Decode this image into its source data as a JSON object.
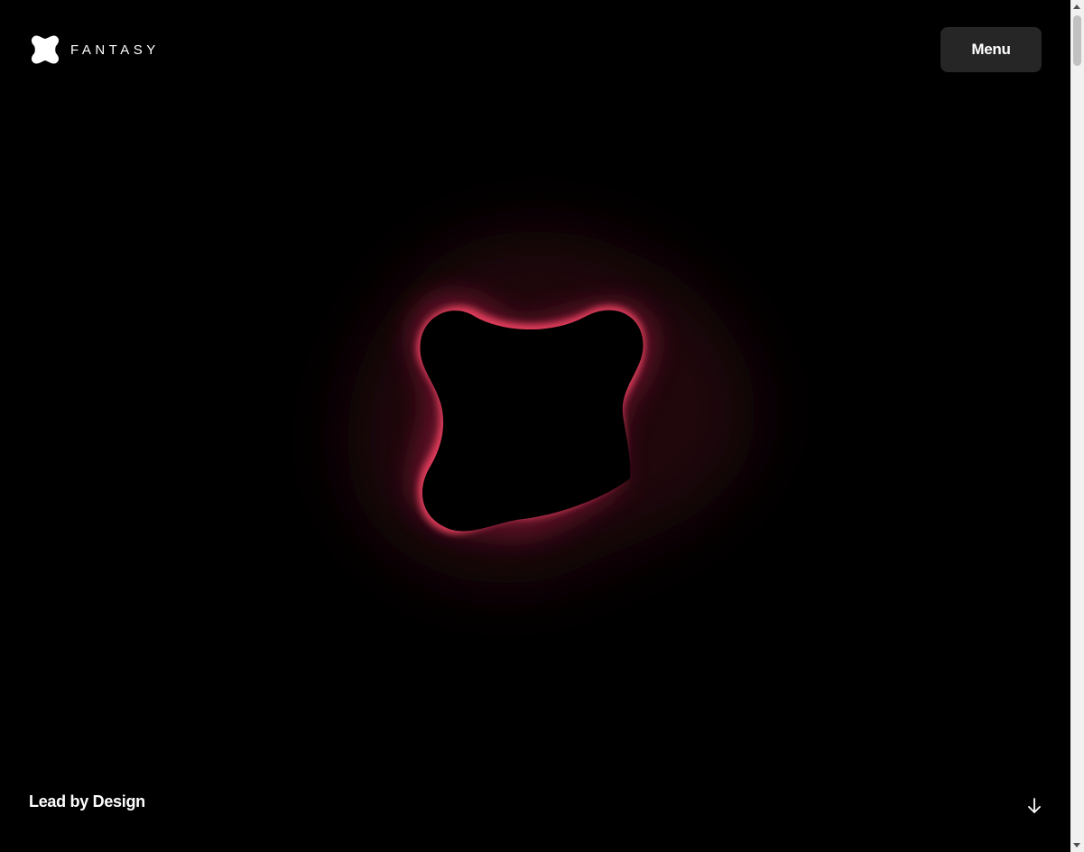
{
  "brand": {
    "name": "FANTASY",
    "logo_icon": "fantasy-logo-icon"
  },
  "header": {
    "menu_label": "Menu"
  },
  "hero": {
    "tagline": "Lead by Design",
    "scroll_icon": "arrow-down-icon",
    "glow_color": "#e8405f"
  }
}
